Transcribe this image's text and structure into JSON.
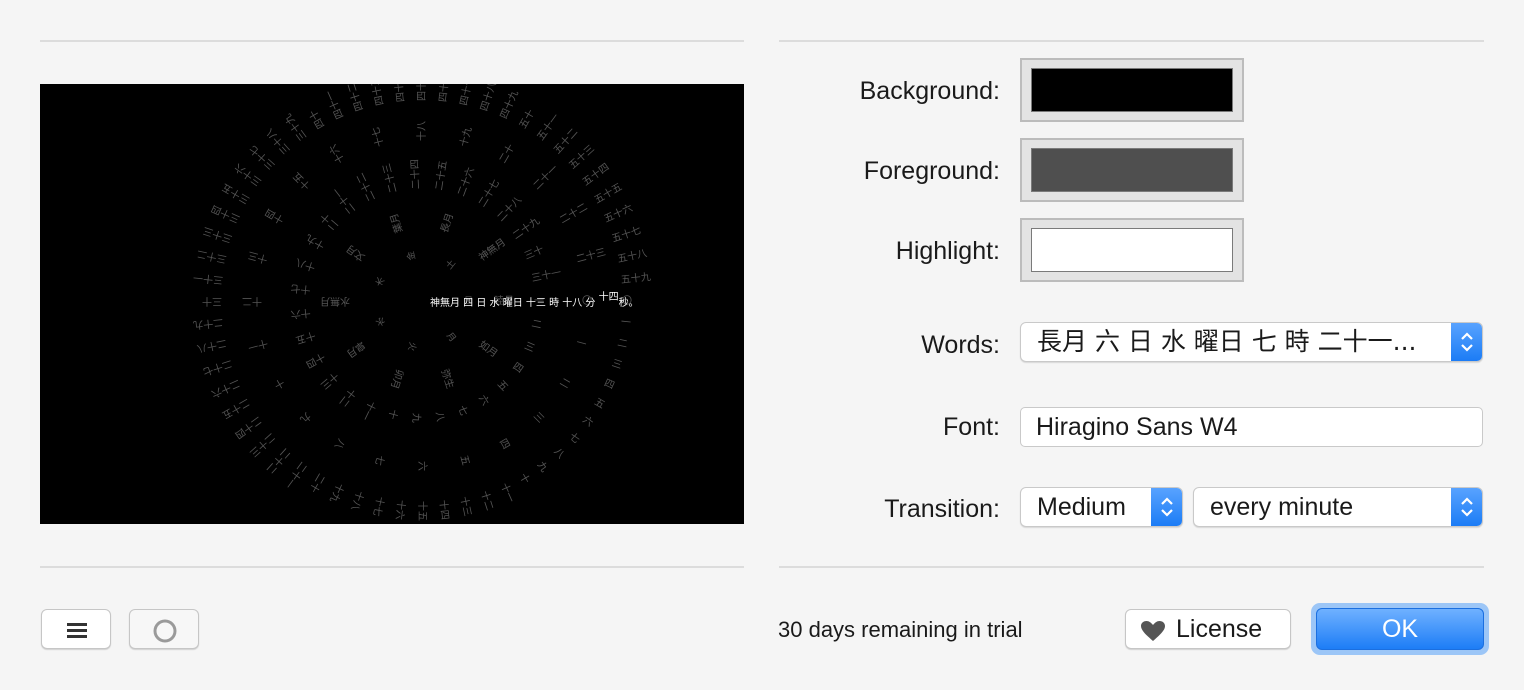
{
  "preview": {
    "center_text": "神無月 四 日 水 曜日 十三 時 十八 分",
    "center_sec": "十四",
    "center_tail": "秒。",
    "months": [
      "睦月",
      "如月",
      "弥生",
      "卯月",
      "皐月",
      "水無月",
      "文月",
      "葉月",
      "長月",
      "神無月"
    ],
    "days": [
      "一",
      "二",
      "三",
      "四",
      "五",
      "六",
      "七",
      "八",
      "九",
      "十",
      "十一",
      "十二",
      "十三",
      "十四",
      "十五",
      "十六",
      "十七",
      "十八",
      "十九",
      "二十",
      "二十一",
      "二十二",
      "二十三",
      "二十四",
      "二十五",
      "二十六",
      "二十七",
      "二十八",
      "二十九",
      "三十",
      "三十一"
    ],
    "weekdays": [
      "日",
      "月",
      "火",
      "水",
      "木",
      "金",
      "土"
    ],
    "hours": [
      "〇",
      "一",
      "二",
      "三",
      "四",
      "五",
      "六",
      "七",
      "八",
      "九",
      "十",
      "十一",
      "十二",
      "十三",
      "十四",
      "十五",
      "十六",
      "十七",
      "十八",
      "十九",
      "二十",
      "二十一",
      "二十二",
      "二十三"
    ],
    "minutes": [
      "〇",
      "一",
      "二",
      "三",
      "四",
      "五",
      "六",
      "七",
      "八",
      "九",
      "十",
      "十一",
      "十二",
      "十三",
      "十四",
      "十五",
      "十六",
      "十七",
      "十八",
      "十九",
      "二十",
      "二十一",
      "二十二",
      "二十三",
      "二十四",
      "二十五",
      "二十六",
      "二十七",
      "二十八",
      "二十九",
      "三十",
      "三十一",
      "三十二",
      "三十三",
      "三十四",
      "三十五",
      "三十六",
      "三十七",
      "三十八",
      "三十九",
      "四十",
      "四十一",
      "四十二",
      "四十三",
      "四十四",
      "四十五",
      "四十六",
      "四十七",
      "四十八",
      "四十九",
      "五十",
      "五十一",
      "五十二",
      "五十三",
      "五十四",
      "五十五",
      "五十六",
      "五十七",
      "五十八",
      "五十九"
    ],
    "fg_color": "#555555",
    "hl_color": "#ffffff"
  },
  "settings": {
    "background_label": "Background:",
    "foreground_label": "Foreground:",
    "highlight_label": "Highlight:",
    "background_color": "#000000",
    "foreground_color": "#4f4f4f",
    "highlight_color": "#ffffff",
    "words_label": "Words:",
    "words_value": "長月 六 日 水 曜日 七 時 二十一...",
    "font_label": "Font:",
    "font_value": "Hiragino Sans W4",
    "transition_label": "Transition:",
    "transition_speed": "Medium",
    "transition_frequency": "every minute"
  },
  "footer": {
    "trial_text": "30 days remaining in trial",
    "license_label": "License",
    "ok_label": "OK",
    "menu_icon": "hamburger-menu-icon",
    "circle_icon": "circle-icon"
  }
}
